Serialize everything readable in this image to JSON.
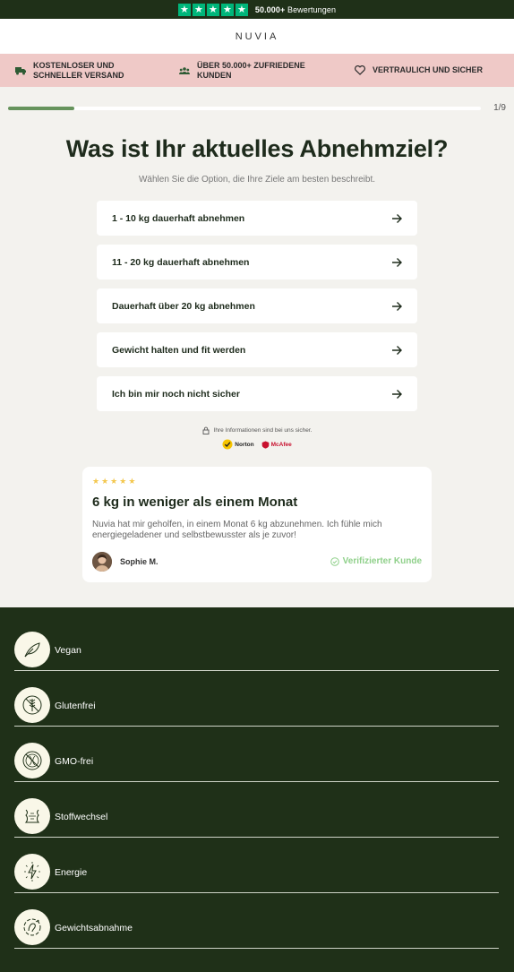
{
  "trust_bar": {
    "rating_stars": 5,
    "reviews_count": "50.000+",
    "reviews_label": "Bewertungen"
  },
  "brand": {
    "logo": "NUVIA"
  },
  "usps": [
    {
      "icon": "truck-icon",
      "text_line1": "KOSTENLOSER UND",
      "text_line2": "SCHNELLER VERSAND"
    },
    {
      "icon": "people-icon",
      "text_line1": "ÜBER 50.000+ ZUFRIEDENE",
      "text_line2": "KUNDEN"
    },
    {
      "icon": "heart-icon",
      "text_line1": "VERTRAULICH UND SICHER",
      "text_line2": ""
    }
  ],
  "progress": {
    "current": 1,
    "total": 9,
    "label": "1/9",
    "fraction": 0.14
  },
  "quiz": {
    "question": "Was ist Ihr aktuelles Abnehmziel?",
    "subtitle": "Wählen Sie die Option, die Ihre Ziele am besten beschreibt.",
    "options": [
      "1 - 10 kg dauerhaft abnehmen",
      "11 - 20 kg dauerhaft abnehmen",
      "Dauerhaft über 20 kg abnehmen",
      "Gewicht halten und fit werden",
      "Ich bin mir noch nicht sicher"
    ]
  },
  "security": {
    "note": "Ihre Informationen sind bei uns sicher.",
    "badges": [
      "Norton",
      "McAfee"
    ]
  },
  "review": {
    "stars": 5,
    "title": "6 kg in weniger als einem Monat",
    "text": "Nuvia hat mir geholfen, in einem Monat 6 kg abzunehmen. Ich fühle mich energiegeladener und selbstbewusster als je zuvor!",
    "author": "Sophie M.",
    "verified": "Verifizierter Kunde"
  },
  "features": [
    {
      "icon": "leaf-icon",
      "label": "Vegan"
    },
    {
      "icon": "wheat-icon",
      "label": "Glutenfrei"
    },
    {
      "icon": "no-gmo-icon",
      "label": "GMO-frei"
    },
    {
      "icon": "metabolism-icon",
      "label": "Stoffwechsel"
    },
    {
      "icon": "energy-icon",
      "label": "Energie"
    },
    {
      "icon": "weight-loss-icon",
      "label": "Gewichtsabnahme"
    }
  ],
  "colors": {
    "dark_green": "#1f3018",
    "trustpilot_green": "#00b67a",
    "usp_pink": "#efc9c7",
    "progress_green": "#66935c",
    "star_yellow": "#f3c74e",
    "verified_green": "#8fd08a"
  }
}
